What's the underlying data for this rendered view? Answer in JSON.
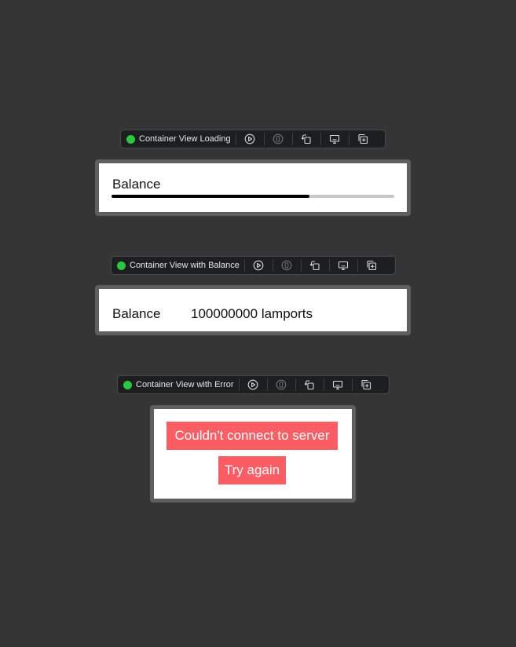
{
  "previews": [
    {
      "title": "Container View Loading",
      "balance_label": "Balance",
      "progress": 0.7
    },
    {
      "title": "Container View with Balance",
      "balance_label": "Balance",
      "balance_value": "100000000 lamports"
    },
    {
      "title": "Container View with Error",
      "error_message": "Couldn't connect to server",
      "retry_label": "Try again"
    }
  ],
  "toolbar_icons": [
    "live-preview-icon",
    "selectable-icon",
    "rotate-device-icon",
    "device-settings-icon",
    "duplicate-preview-icon"
  ],
  "colors": {
    "status_dot": "#28c840",
    "error": "#fb5d64",
    "background": "#353535"
  }
}
